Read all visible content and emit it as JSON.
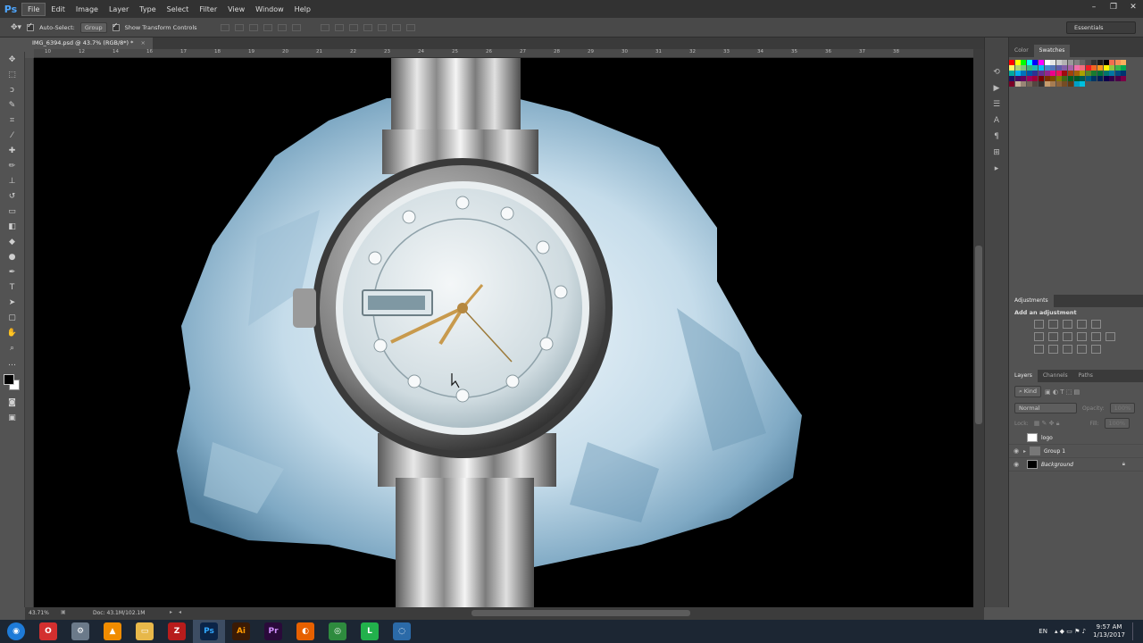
{
  "app": {
    "logo": "Ps"
  },
  "menu": [
    "File",
    "Edit",
    "Image",
    "Layer",
    "Type",
    "Select",
    "Filter",
    "View",
    "Window",
    "Help"
  ],
  "options_bar": {
    "auto_select_label": "Auto-Select:",
    "auto_select_value": "Group",
    "transform_label": "Show Transform Controls",
    "workspace": "Essentials"
  },
  "document": {
    "tab_title": "IMG_6394.psd @ 43.7% (RGB/8*) *",
    "zoom": "43.71%",
    "doc_size": "Doc: 43.1M/102.1M"
  },
  "rulers": {
    "top_ticks": [
      "10",
      "12",
      "14",
      "16",
      "17",
      "18",
      "19",
      "20",
      "21",
      "22",
      "23",
      "24",
      "25",
      "26",
      "27",
      "28",
      "29",
      "30",
      "31",
      "32",
      "33",
      "34",
      "35",
      "36",
      "37",
      "38"
    ]
  },
  "panels": {
    "color_tabs": [
      "Color",
      "Swatches"
    ],
    "adjustments_tab": "Adjustments",
    "adjustments_title": "Add an adjustment",
    "layers_tabs": [
      "Layers",
      "Channels",
      "Paths"
    ],
    "kind_label": "Kind",
    "blend_mode": "Normal",
    "opacity_label": "Opacity:",
    "opacity_value": "100%",
    "lock_label": "Lock:",
    "fill_label": "Fill:",
    "fill_value": "100%",
    "layers": [
      {
        "name": "logo",
        "visible": false
      },
      {
        "name": "Group 1",
        "visible": true
      },
      {
        "name": "Background",
        "visible": true
      }
    ]
  },
  "swatch_colors": [
    "#ff0000",
    "#ffff00",
    "#00ff00",
    "#00ffff",
    "#0000ff",
    "#ff00ff",
    "#ffffff",
    "#e6e6e6",
    "#cccccc",
    "#b3b3b3",
    "#999999",
    "#808080",
    "#666666",
    "#4d4d4d",
    "#333333",
    "#1a1a1a",
    "#000000",
    "#f26c4f",
    "#f68e56",
    "#fbaf5d",
    "#fff568",
    "#acd372",
    "#7cc576",
    "#3bb878",
    "#1abbb4",
    "#00bff3",
    "#438cca",
    "#5574b9",
    "#605ca8",
    "#855fa8",
    "#a763a8",
    "#f06ea9",
    "#f26d7d",
    "#ed1c24",
    "#f26522",
    "#f7941d",
    "#fff200",
    "#8dc63f",
    "#39b54a",
    "#00a651",
    "#00a99d",
    "#00aeef",
    "#0072bc",
    "#0054a6",
    "#2e3192",
    "#662d91",
    "#92278f",
    "#ec008c",
    "#ed145b",
    "#9e0b0f",
    "#a0410d",
    "#a36209",
    "#aba000",
    "#598527",
    "#1a7b30",
    "#007236",
    "#00746b",
    "#0076a3",
    "#004b80",
    "#003471",
    "#1b1464",
    "#440e62",
    "#630460",
    "#9e005d",
    "#9e0039",
    "#790000",
    "#7b2e00",
    "#7d4900",
    "#827b00",
    "#406618",
    "#005e20",
    "#005826",
    "#005952",
    "#005b7f",
    "#003663",
    "#002157",
    "#0d004c",
    "#32004b",
    "#4b0049",
    "#7b0046",
    "#7a0026",
    "#c7b299",
    "#998675",
    "#736357",
    "#534741",
    "#37302d",
    "#c69c6d",
    "#a67c52",
    "#8c6239",
    "#754c24",
    "#603913",
    "#00a0c6",
    "#00c0e0"
  ],
  "taskbar": {
    "apps": [
      "Start",
      "Opera",
      "Settings",
      "VLC",
      "Explorer",
      "FileZilla",
      "Photoshop",
      "Illustrator",
      "Premiere",
      "Firefox",
      "Chrome",
      "LINE",
      "Tool"
    ],
    "lang": "EN",
    "time": "9:57 AM",
    "date": "1/13/2017"
  }
}
